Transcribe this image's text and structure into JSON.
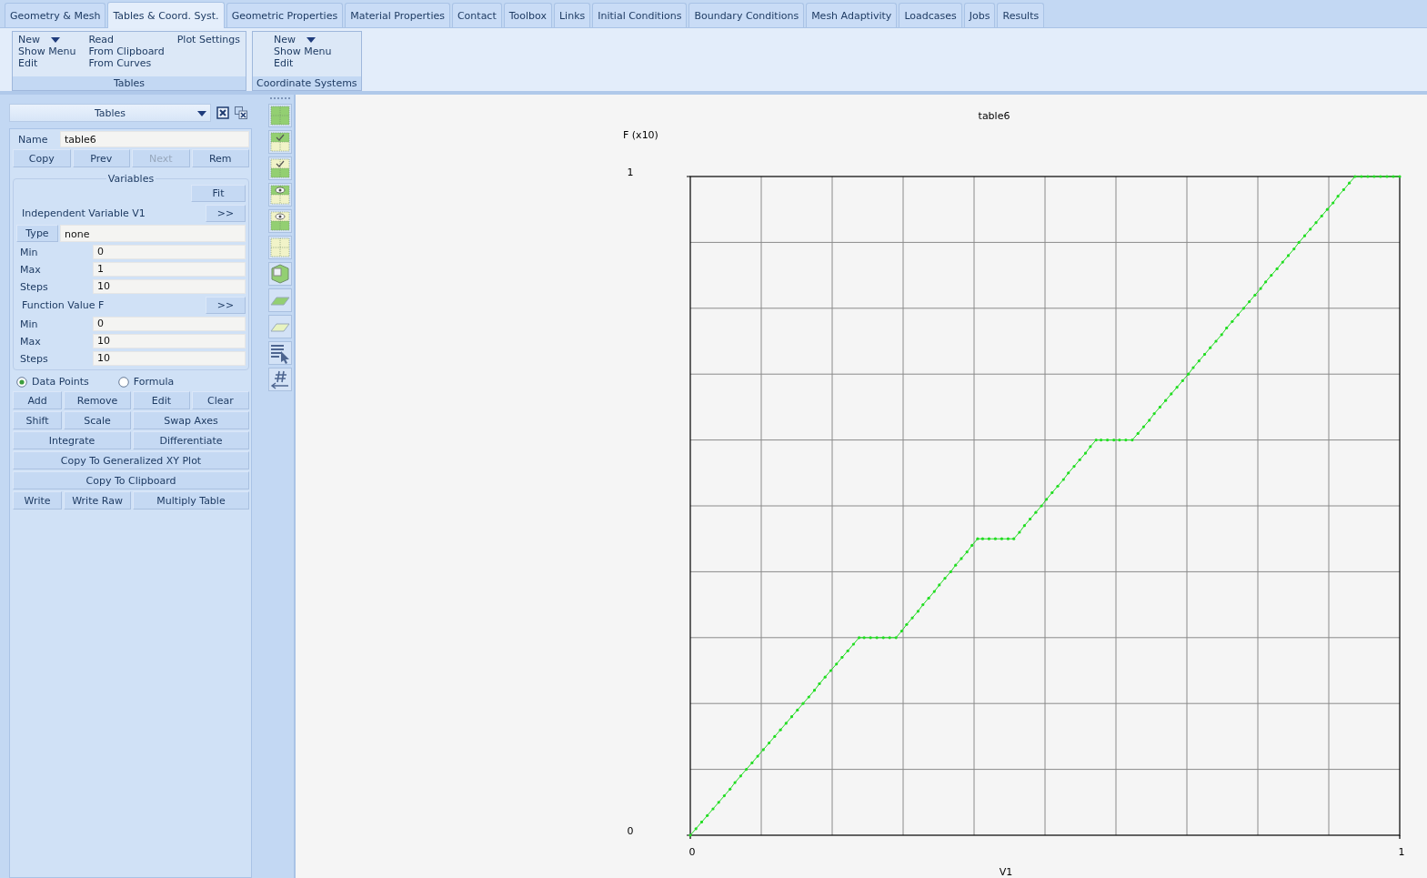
{
  "tabs": [
    {
      "label": "Geometry & Mesh",
      "selected": false
    },
    {
      "label": "Tables & Coord. Syst.",
      "selected": true
    },
    {
      "label": "Geometric Properties",
      "selected": false
    },
    {
      "label": "Material Properties",
      "selected": false
    },
    {
      "label": "Contact",
      "selected": false
    },
    {
      "label": "Toolbox",
      "selected": false
    },
    {
      "label": "Links",
      "selected": false
    },
    {
      "label": "Initial Conditions",
      "selected": false
    },
    {
      "label": "Boundary Conditions",
      "selected": false
    },
    {
      "label": "Mesh Adaptivity",
      "selected": false
    },
    {
      "label": "Loadcases",
      "selected": false
    },
    {
      "label": "Jobs",
      "selected": false
    },
    {
      "label": "Results",
      "selected": false
    }
  ],
  "ribbon": {
    "groups": [
      {
        "title": "Tables",
        "columns": [
          [
            "New",
            "Show Menu",
            "Edit"
          ],
          [
            "Read",
            "From Clipboard",
            "From Curves"
          ],
          [
            "Plot Settings"
          ]
        ]
      },
      {
        "title": "Coordinate Systems",
        "columns": [
          [
            "New",
            "Show Menu",
            "Edit"
          ]
        ]
      }
    ]
  },
  "panel": {
    "selector": "Tables",
    "name_label": "Name",
    "name_value": "table6",
    "nav_buttons": [
      {
        "label": "Copy",
        "disabled": false
      },
      {
        "label": "Prev",
        "disabled": false
      },
      {
        "label": "Next",
        "disabled": true
      },
      {
        "label": "Rem",
        "disabled": false
      }
    ],
    "variables": {
      "legend": "Variables",
      "fit": "Fit",
      "independent_label": "Independent Variable V1",
      "independent_expand": ">>",
      "type_button": "Type",
      "type_value": "none",
      "independent_fields": [
        {
          "label": "Min",
          "value": "0"
        },
        {
          "label": "Max",
          "value": "1"
        },
        {
          "label": "Steps",
          "value": "10"
        }
      ],
      "function_label": "Function Value F",
      "function_expand": ">>",
      "function_fields": [
        {
          "label": "Min",
          "value": "0"
        },
        {
          "label": "Max",
          "value": "10"
        },
        {
          "label": "Steps",
          "value": "10"
        }
      ]
    },
    "modes": [
      {
        "label": "Data Points",
        "selected": true
      },
      {
        "label": "Formula",
        "selected": false
      }
    ],
    "button_rows": [
      [
        "Add",
        "Remove",
        "Edit",
        "Clear"
      ],
      [
        "Shift",
        "Scale",
        "Swap Axes"
      ],
      [
        "Integrate",
        "Differentiate"
      ],
      [
        "Copy To Generalized XY Plot"
      ],
      [
        "Copy To Clipboard"
      ],
      [
        "Write",
        "Write Raw",
        "Multiply Table"
      ]
    ]
  },
  "plot": {
    "chart_data": {
      "type": "line",
      "title": "table6",
      "xlabel": "V1",
      "ylabel": "F (x10)",
      "xlim": [
        0,
        1
      ],
      "ylim": [
        0,
        1
      ],
      "xticks": [
        0,
        1
      ],
      "yticks": [
        0,
        1
      ],
      "x": [
        0,
        0.008,
        0.016,
        0.024,
        0.032,
        0.04,
        0.048,
        0.056,
        0.063,
        0.071,
        0.079,
        0.087,
        0.095,
        0.103,
        0.111,
        0.119,
        0.127,
        0.135,
        0.143,
        0.151,
        0.159,
        0.167,
        0.175,
        0.182,
        0.19,
        0.198,
        0.206,
        0.214,
        0.222,
        0.23,
        0.238,
        0.245,
        0.254,
        0.263,
        0.272,
        0.281,
        0.29,
        0.298,
        0.305,
        0.313,
        0.321,
        0.328,
        0.336,
        0.344,
        0.351,
        0.359,
        0.367,
        0.374,
        0.382,
        0.39,
        0.397,
        0.405,
        0.412,
        0.421,
        0.43,
        0.439,
        0.448,
        0.456,
        0.464,
        0.471,
        0.479,
        0.487,
        0.495,
        0.502,
        0.51,
        0.518,
        0.526,
        0.533,
        0.541,
        0.549,
        0.557,
        0.564,
        0.572,
        0.579,
        0.588,
        0.597,
        0.605,
        0.614,
        0.623,
        0.631,
        0.639,
        0.647,
        0.654,
        0.662,
        0.67,
        0.678,
        0.686,
        0.694,
        0.702,
        0.709,
        0.717,
        0.725,
        0.733,
        0.741,
        0.749,
        0.756,
        0.764,
        0.772,
        0.78,
        0.788,
        0.796,
        0.804,
        0.811,
        0.819,
        0.827,
        0.835,
        0.843,
        0.851,
        0.858,
        0.866,
        0.874,
        0.882,
        0.89,
        0.898,
        0.906,
        0.913,
        0.921,
        0.929,
        0.937,
        0.946,
        0.955,
        0.964,
        0.973,
        0.982,
        0.991,
        1
      ],
      "series": [
        {
          "color": "#22dd22",
          "values": [
            0,
            0.01,
            0.02,
            0.03,
            0.04,
            0.05,
            0.06,
            0.07,
            0.08,
            0.09,
            0.1,
            0.11,
            0.12,
            0.13,
            0.14,
            0.15,
            0.16,
            0.17,
            0.18,
            0.19,
            0.2,
            0.21,
            0.22,
            0.23,
            0.24,
            0.25,
            0.26,
            0.27,
            0.28,
            0.29,
            0.3,
            0.3,
            0.3,
            0.3,
            0.3,
            0.3,
            0.3,
            0.31,
            0.32,
            0.33,
            0.34,
            0.35,
            0.36,
            0.37,
            0.38,
            0.39,
            0.4,
            0.41,
            0.42,
            0.43,
            0.44,
            0.45,
            0.45,
            0.45,
            0.45,
            0.45,
            0.45,
            0.45,
            0.46,
            0.47,
            0.48,
            0.49,
            0.5,
            0.51,
            0.52,
            0.53,
            0.54,
            0.55,
            0.56,
            0.57,
            0.58,
            0.59,
            0.6,
            0.6,
            0.6,
            0.6,
            0.6,
            0.6,
            0.6,
            0.61,
            0.62,
            0.63,
            0.64,
            0.65,
            0.66,
            0.67,
            0.68,
            0.69,
            0.7,
            0.71,
            0.72,
            0.73,
            0.74,
            0.75,
            0.76,
            0.77,
            0.78,
            0.79,
            0.8,
            0.81,
            0.82,
            0.83,
            0.84,
            0.85,
            0.86,
            0.87,
            0.88,
            0.89,
            0.9,
            0.91,
            0.92,
            0.93,
            0.94,
            0.95,
            0.96,
            0.97,
            0.98,
            0.99,
            1,
            1,
            1,
            1,
            1,
            1,
            1,
            1
          ]
        }
      ]
    }
  }
}
